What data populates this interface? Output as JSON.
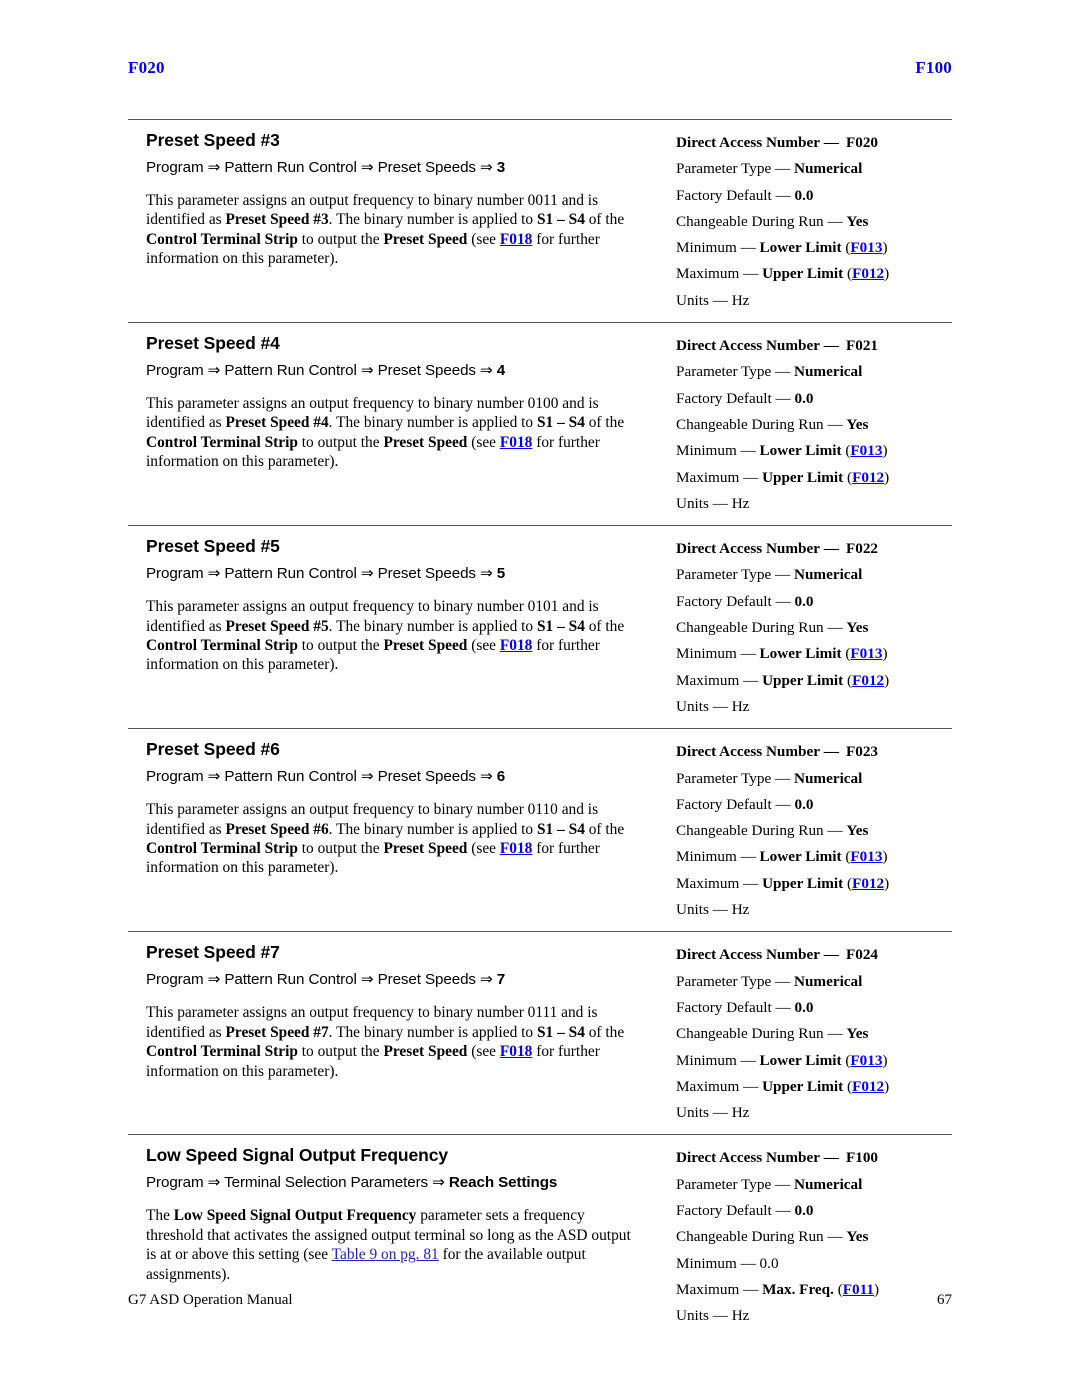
{
  "running_header": {
    "left": "F020",
    "right": "F100"
  },
  "spec_labels": {
    "direct_access": "Direct Access Number",
    "parameter_type": "Parameter Type",
    "factory_default": "Factory Default",
    "changeable": "Changeable During Run",
    "minimum": "Minimum",
    "maximum": "Maximum",
    "units": "Units",
    "dash": "—"
  },
  "common": {
    "parameter_type_value": "Numerical",
    "factory_default_value": "0.0",
    "changeable_value": "Yes",
    "units_value": "Hz",
    "lower_limit": "Lower Limit",
    "upper_limit": "Upper Limit",
    "max_freq": "Max. Freq.",
    "ref_f013": "F013",
    "ref_f012": "F012",
    "ref_f011": "F011",
    "ref_f018": "F018",
    "min_zero": "0.0"
  },
  "sections": [
    {
      "title": "Preset Speed #3",
      "path_prefix": "Program ⇒ Pattern Run Control ⇒ Preset Speeds ⇒ ",
      "path_value": "3",
      "body_1": "This parameter assigns an output frequency to binary number 0011 and is identified as ",
      "body_b1": "Preset Speed #3",
      "body_2": ". The binary number is applied to ",
      "body_b2": "S1 – S4",
      "body_3": " of the ",
      "body_b3": "Control Terminal Strip",
      "body_4": " to output the ",
      "body_b4": "Preset Speed",
      "body_5": " (see ",
      "body_link": "F018",
      "body_6": " for further information on this parameter).",
      "direct_access_value": "F020",
      "minimum_value": "Lower Limit",
      "minimum_ref": "F013",
      "maximum_value": "Upper Limit",
      "maximum_ref": "F012"
    },
    {
      "title": "Preset Speed #4",
      "path_prefix": "Program ⇒ Pattern Run Control ⇒ Preset Speeds ⇒ ",
      "path_value": "4",
      "body_1": "This parameter assigns an output frequency to binary number 0100 and is identified as ",
      "body_b1": "Preset Speed #4",
      "body_2": ". The binary number is applied to ",
      "body_b2": "S1 – S4",
      "body_3": " of the ",
      "body_b3": "Control Terminal Strip",
      "body_4": " to output the ",
      "body_b4": "Preset Speed",
      "body_5": " (see ",
      "body_link": "F018",
      "body_6": " for further information on this parameter).",
      "direct_access_value": "F021",
      "minimum_value": "Lower Limit",
      "minimum_ref": "F013",
      "maximum_value": "Upper Limit",
      "maximum_ref": "F012"
    },
    {
      "title": "Preset Speed #5",
      "path_prefix": "Program ⇒ Pattern Run Control ⇒ Preset Speeds ⇒ ",
      "path_value": "5",
      "body_1": "This parameter assigns an output frequency to binary number 0101 and is identified as ",
      "body_b1": "Preset Speed #5",
      "body_2": ". The binary number is applied to ",
      "body_b2": "S1 – S4",
      "body_3": " of the ",
      "body_b3": "Control Terminal Strip",
      "body_4": " to output the ",
      "body_b4": "Preset Speed",
      "body_5": " (see ",
      "body_link": "F018",
      "body_6": " for further information on this parameter).",
      "direct_access_value": "F022",
      "minimum_value": "Lower Limit",
      "minimum_ref": "F013",
      "maximum_value": "Upper Limit",
      "maximum_ref": "F012"
    },
    {
      "title": "Preset Speed #6",
      "path_prefix": "Program ⇒ Pattern Run Control ⇒ Preset Speeds ⇒ ",
      "path_value": "6",
      "body_1": "This parameter assigns an output frequency to binary number 0110 and is identified as ",
      "body_b1": "Preset Speed #6",
      "body_2": ". The binary number is applied to ",
      "body_b2": "S1 – S4",
      "body_3": " of the ",
      "body_b3": "Control Terminal Strip",
      "body_4": " to output the ",
      "body_b4": "Preset Speed",
      "body_5": " (see ",
      "body_link": "F018",
      "body_6": " for further information on this parameter).",
      "direct_access_value": "F023",
      "minimum_value": "Lower Limit",
      "minimum_ref": "F013",
      "maximum_value": "Upper Limit",
      "maximum_ref": "F012"
    },
    {
      "title": "Preset Speed #7",
      "path_prefix": "Program ⇒ Pattern Run Control ⇒ Preset Speeds ⇒ ",
      "path_value": "7",
      "body_1": "This parameter assigns an output frequency to binary number 0111 and is identified as ",
      "body_b1": "Preset Speed #7",
      "body_2": ". The binary number is applied to ",
      "body_b2": "S1 – S4",
      "body_3": " of the ",
      "body_b3": "Control Terminal Strip",
      "body_4": " to output the ",
      "body_b4": "Preset Speed",
      "body_5": " (see ",
      "body_link": "F018",
      "body_6": " for further information on this parameter).",
      "direct_access_value": "F024",
      "minimum_value": "Lower Limit",
      "minimum_ref": "F013",
      "maximum_value": "Upper Limit",
      "maximum_ref": "F012"
    }
  ],
  "last_section": {
    "title": "Low Speed Signal Output Frequency",
    "path_prefix": "Program ⇒ Terminal Selection Parameters ⇒ ",
    "path_value": "Reach Settings",
    "body_1": "The ",
    "body_b1": "Low Speed Signal Output Frequency",
    "body_2": " parameter sets a frequency threshold that activates the assigned output terminal so long as the ASD output is at or above this setting (see ",
    "body_link": "Table 9 on pg. 81",
    "body_3": " for the available output assignments).",
    "direct_access_value": "F100",
    "minimum_value": "0.0",
    "maximum_value": "Max. Freq.",
    "maximum_ref": "F011"
  },
  "footer": {
    "manual_title": "G7 ASD Operation Manual",
    "page_number": "67"
  }
}
